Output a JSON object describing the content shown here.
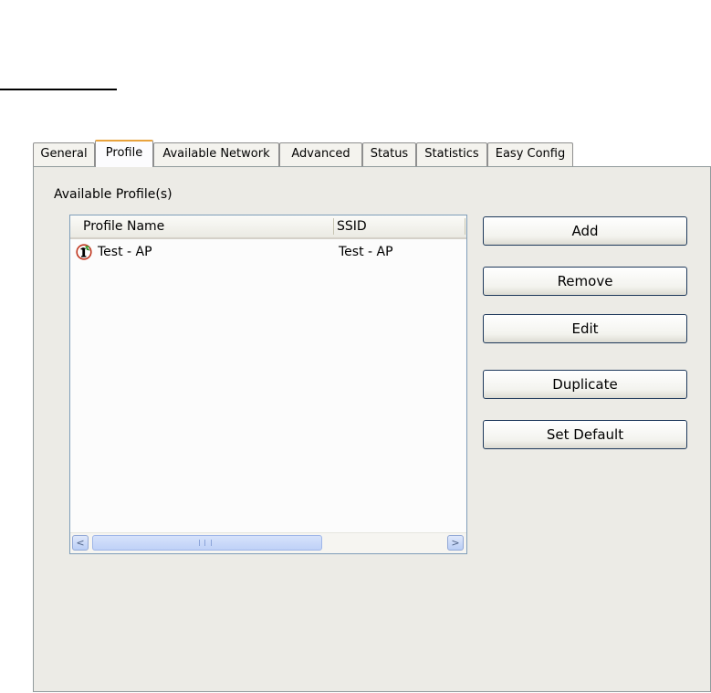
{
  "tabs": [
    {
      "label": "General"
    },
    {
      "label": "Profile"
    },
    {
      "label": "Available Network"
    },
    {
      "label": "Advanced"
    },
    {
      "label": "Status"
    },
    {
      "label": "Statistics"
    },
    {
      "label": "Easy Config"
    }
  ],
  "active_tab": "Profile",
  "panel": {
    "group_label": "Available Profile(s)",
    "list": {
      "columns": [
        "Profile Name",
        "SSID"
      ],
      "rows": [
        {
          "profile_name": "Test - AP",
          "ssid": "Test - AP",
          "icon": "active-profile-icon"
        }
      ]
    },
    "buttons": {
      "add": "Add",
      "remove": "Remove",
      "edit": "Edit",
      "duplicate": "Duplicate",
      "set_default": "Set Default"
    }
  },
  "scrollbar": {
    "left_arrow": "<",
    "right_arrow": ">"
  }
}
